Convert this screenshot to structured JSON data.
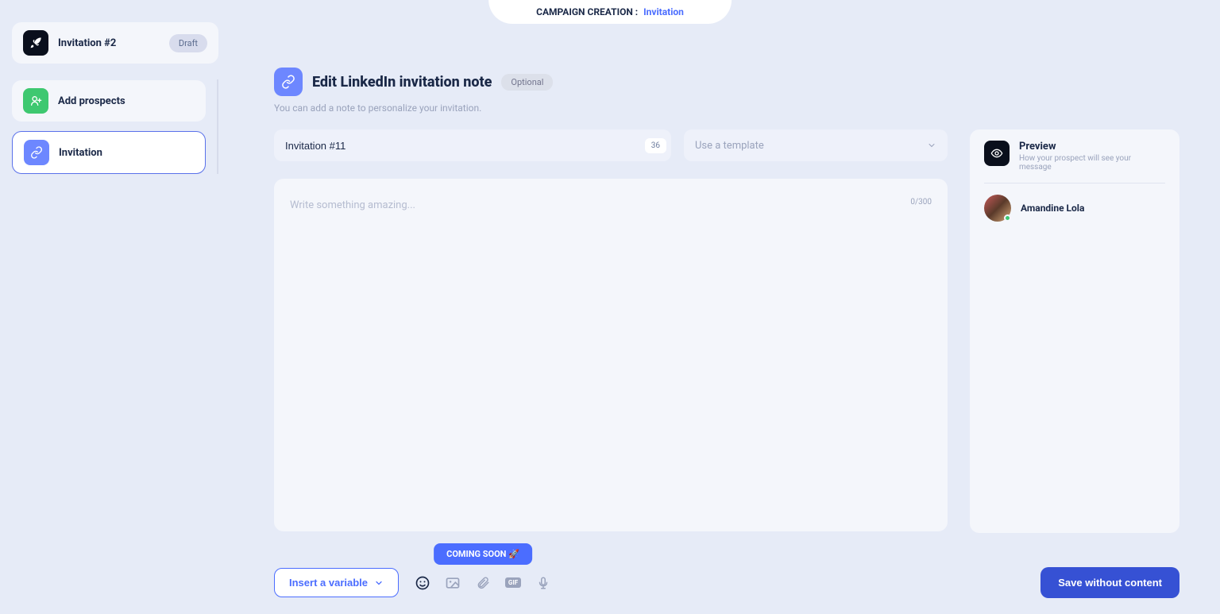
{
  "banner": {
    "label": "CAMPAIGN CREATION :",
    "suffix": "Invitation"
  },
  "campaign": {
    "name": "Invitation #2",
    "status": "Draft"
  },
  "sidebar": {
    "items": [
      {
        "label": "Add prospects"
      },
      {
        "label": "Invitation"
      }
    ]
  },
  "header": {
    "title": "Edit LinkedIn invitation note",
    "optional": "Optional",
    "sub": "You can add a note to personalize your invitation."
  },
  "editor": {
    "title_value": "Invitation #11",
    "title_count": "36",
    "template_placeholder": "Use a template",
    "message_placeholder": "Write something amazing...",
    "char_counter": "0/300"
  },
  "preview": {
    "title": "Preview",
    "sub": "How your prospect will see your message",
    "prospect_name": "Amandine Lola"
  },
  "toolbar": {
    "insert_variable": "Insert a variable",
    "coming_soon": "COMING SOON 🚀",
    "gif": "GIF"
  },
  "save_button": "Save without content"
}
